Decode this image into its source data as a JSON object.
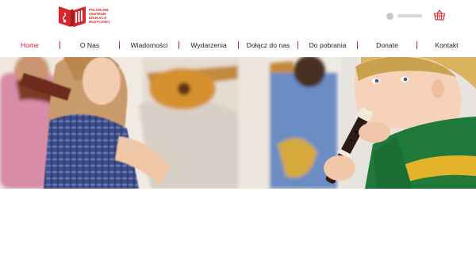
{
  "logo": {
    "text_lines": [
      "POLONIJNE",
      "CENTRUM",
      "EDUKACJI",
      "MUZYCZNEJ"
    ],
    "brand_color": "#d7262b"
  },
  "header": {
    "login_icon": "user-avatar-icon",
    "cart_icon": "shopping-basket-icon"
  },
  "nav": {
    "active_color": "#d7262b",
    "items": [
      {
        "label": "Home",
        "active": true
      },
      {
        "label": "O Nas",
        "active": false
      },
      {
        "label": "Wiadomości",
        "active": false
      },
      {
        "label": "Wydarzenia",
        "active": false
      },
      {
        "label": "Dołącz do nas",
        "active": false
      },
      {
        "label": "Do pobrania",
        "active": false
      },
      {
        "label": "Donate",
        "active": false
      },
      {
        "label": "Kontakt",
        "active": false
      }
    ]
  },
  "hero": {
    "image_subject": "children-playing-instruments-photo"
  }
}
